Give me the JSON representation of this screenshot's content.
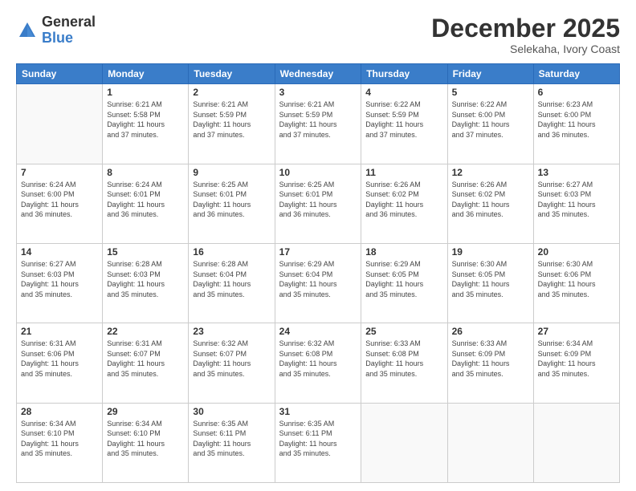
{
  "logo": {
    "general": "General",
    "blue": "Blue"
  },
  "title": "December 2025",
  "location": "Selekaha, Ivory Coast",
  "weekdays": [
    "Sunday",
    "Monday",
    "Tuesday",
    "Wednesday",
    "Thursday",
    "Friday",
    "Saturday"
  ],
  "weeks": [
    [
      {
        "day": "",
        "info": ""
      },
      {
        "day": "1",
        "info": "Sunrise: 6:21 AM\nSunset: 5:58 PM\nDaylight: 11 hours\nand 37 minutes."
      },
      {
        "day": "2",
        "info": "Sunrise: 6:21 AM\nSunset: 5:59 PM\nDaylight: 11 hours\nand 37 minutes."
      },
      {
        "day": "3",
        "info": "Sunrise: 6:21 AM\nSunset: 5:59 PM\nDaylight: 11 hours\nand 37 minutes."
      },
      {
        "day": "4",
        "info": "Sunrise: 6:22 AM\nSunset: 5:59 PM\nDaylight: 11 hours\nand 37 minutes."
      },
      {
        "day": "5",
        "info": "Sunrise: 6:22 AM\nSunset: 6:00 PM\nDaylight: 11 hours\nand 37 minutes."
      },
      {
        "day": "6",
        "info": "Sunrise: 6:23 AM\nSunset: 6:00 PM\nDaylight: 11 hours\nand 36 minutes."
      }
    ],
    [
      {
        "day": "7",
        "info": "Sunrise: 6:24 AM\nSunset: 6:00 PM\nDaylight: 11 hours\nand 36 minutes."
      },
      {
        "day": "8",
        "info": "Sunrise: 6:24 AM\nSunset: 6:01 PM\nDaylight: 11 hours\nand 36 minutes."
      },
      {
        "day": "9",
        "info": "Sunrise: 6:25 AM\nSunset: 6:01 PM\nDaylight: 11 hours\nand 36 minutes."
      },
      {
        "day": "10",
        "info": "Sunrise: 6:25 AM\nSunset: 6:01 PM\nDaylight: 11 hours\nand 36 minutes."
      },
      {
        "day": "11",
        "info": "Sunrise: 6:26 AM\nSunset: 6:02 PM\nDaylight: 11 hours\nand 36 minutes."
      },
      {
        "day": "12",
        "info": "Sunrise: 6:26 AM\nSunset: 6:02 PM\nDaylight: 11 hours\nand 36 minutes."
      },
      {
        "day": "13",
        "info": "Sunrise: 6:27 AM\nSunset: 6:03 PM\nDaylight: 11 hours\nand 35 minutes."
      }
    ],
    [
      {
        "day": "14",
        "info": "Sunrise: 6:27 AM\nSunset: 6:03 PM\nDaylight: 11 hours\nand 35 minutes."
      },
      {
        "day": "15",
        "info": "Sunrise: 6:28 AM\nSunset: 6:03 PM\nDaylight: 11 hours\nand 35 minutes."
      },
      {
        "day": "16",
        "info": "Sunrise: 6:28 AM\nSunset: 6:04 PM\nDaylight: 11 hours\nand 35 minutes."
      },
      {
        "day": "17",
        "info": "Sunrise: 6:29 AM\nSunset: 6:04 PM\nDaylight: 11 hours\nand 35 minutes."
      },
      {
        "day": "18",
        "info": "Sunrise: 6:29 AM\nSunset: 6:05 PM\nDaylight: 11 hours\nand 35 minutes."
      },
      {
        "day": "19",
        "info": "Sunrise: 6:30 AM\nSunset: 6:05 PM\nDaylight: 11 hours\nand 35 minutes."
      },
      {
        "day": "20",
        "info": "Sunrise: 6:30 AM\nSunset: 6:06 PM\nDaylight: 11 hours\nand 35 minutes."
      }
    ],
    [
      {
        "day": "21",
        "info": "Sunrise: 6:31 AM\nSunset: 6:06 PM\nDaylight: 11 hours\nand 35 minutes."
      },
      {
        "day": "22",
        "info": "Sunrise: 6:31 AM\nSunset: 6:07 PM\nDaylight: 11 hours\nand 35 minutes."
      },
      {
        "day": "23",
        "info": "Sunrise: 6:32 AM\nSunset: 6:07 PM\nDaylight: 11 hours\nand 35 minutes."
      },
      {
        "day": "24",
        "info": "Sunrise: 6:32 AM\nSunset: 6:08 PM\nDaylight: 11 hours\nand 35 minutes."
      },
      {
        "day": "25",
        "info": "Sunrise: 6:33 AM\nSunset: 6:08 PM\nDaylight: 11 hours\nand 35 minutes."
      },
      {
        "day": "26",
        "info": "Sunrise: 6:33 AM\nSunset: 6:09 PM\nDaylight: 11 hours\nand 35 minutes."
      },
      {
        "day": "27",
        "info": "Sunrise: 6:34 AM\nSunset: 6:09 PM\nDaylight: 11 hours\nand 35 minutes."
      }
    ],
    [
      {
        "day": "28",
        "info": "Sunrise: 6:34 AM\nSunset: 6:10 PM\nDaylight: 11 hours\nand 35 minutes."
      },
      {
        "day": "29",
        "info": "Sunrise: 6:34 AM\nSunset: 6:10 PM\nDaylight: 11 hours\nand 35 minutes."
      },
      {
        "day": "30",
        "info": "Sunrise: 6:35 AM\nSunset: 6:11 PM\nDaylight: 11 hours\nand 35 minutes."
      },
      {
        "day": "31",
        "info": "Sunrise: 6:35 AM\nSunset: 6:11 PM\nDaylight: 11 hours\nand 35 minutes."
      },
      {
        "day": "",
        "info": ""
      },
      {
        "day": "",
        "info": ""
      },
      {
        "day": "",
        "info": ""
      }
    ]
  ]
}
